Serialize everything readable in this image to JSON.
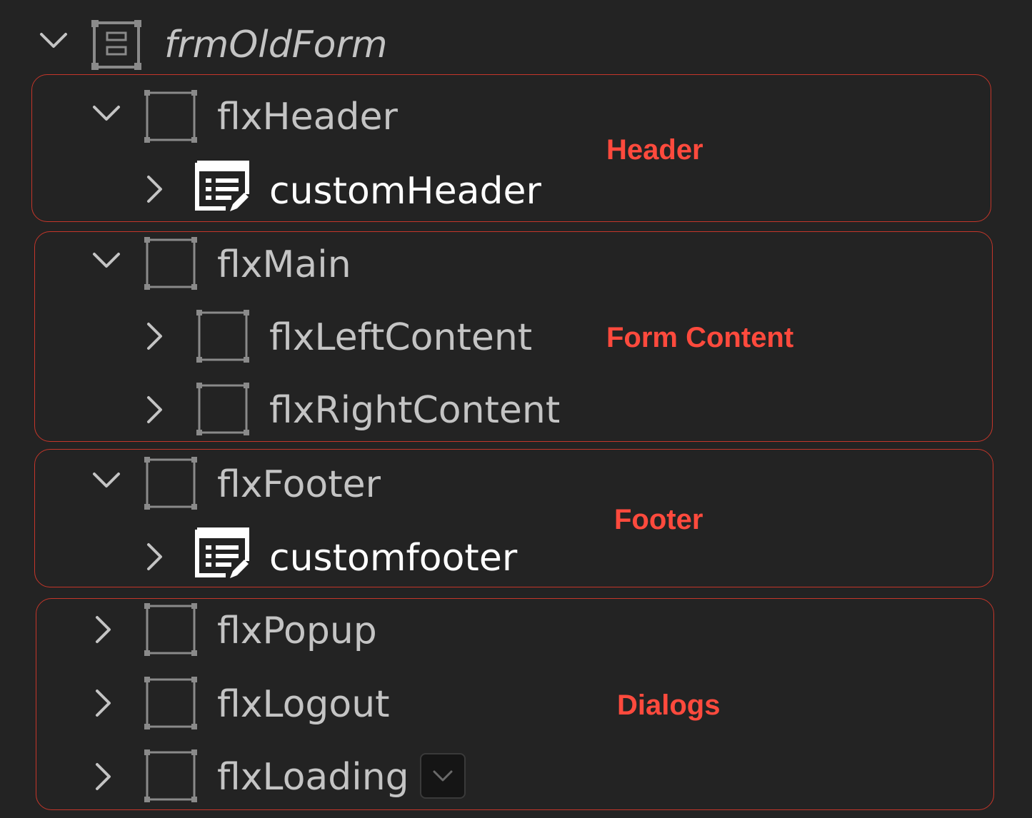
{
  "tree": {
    "root": {
      "label": "frmOldForm",
      "icon": "form-icon",
      "expanded": true
    },
    "nodes": [
      {
        "label": "flxHeader",
        "icon": "flex-container-icon",
        "expanded": true
      },
      {
        "label": "customHeader",
        "icon": "component-edit-icon",
        "expanded": false
      },
      {
        "label": "flxMain",
        "icon": "flex-container-icon",
        "expanded": true
      },
      {
        "label": "flxLeftContent",
        "icon": "flex-container-icon",
        "expanded": false
      },
      {
        "label": "flxRightContent",
        "icon": "flex-container-icon",
        "expanded": false
      },
      {
        "label": "flxFooter",
        "icon": "flex-container-icon",
        "expanded": true
      },
      {
        "label": "customfooter",
        "icon": "component-edit-icon",
        "expanded": false
      },
      {
        "label": "flxPopup",
        "icon": "flex-container-icon",
        "expanded": false
      },
      {
        "label": "flxLogout",
        "icon": "flex-container-icon",
        "expanded": false
      },
      {
        "label": "flxLoading",
        "icon": "flex-container-icon",
        "expanded": false
      }
    ]
  },
  "annotations": {
    "header": "Header",
    "content": "Form Content",
    "footer": "Footer",
    "dialogs": "Dialogs"
  },
  "colors": {
    "background": "#232323",
    "label": "#c4c4c4",
    "label_selected": "#ffffff",
    "annotation": "#ff4a3d",
    "group_border": "#c4362a"
  }
}
